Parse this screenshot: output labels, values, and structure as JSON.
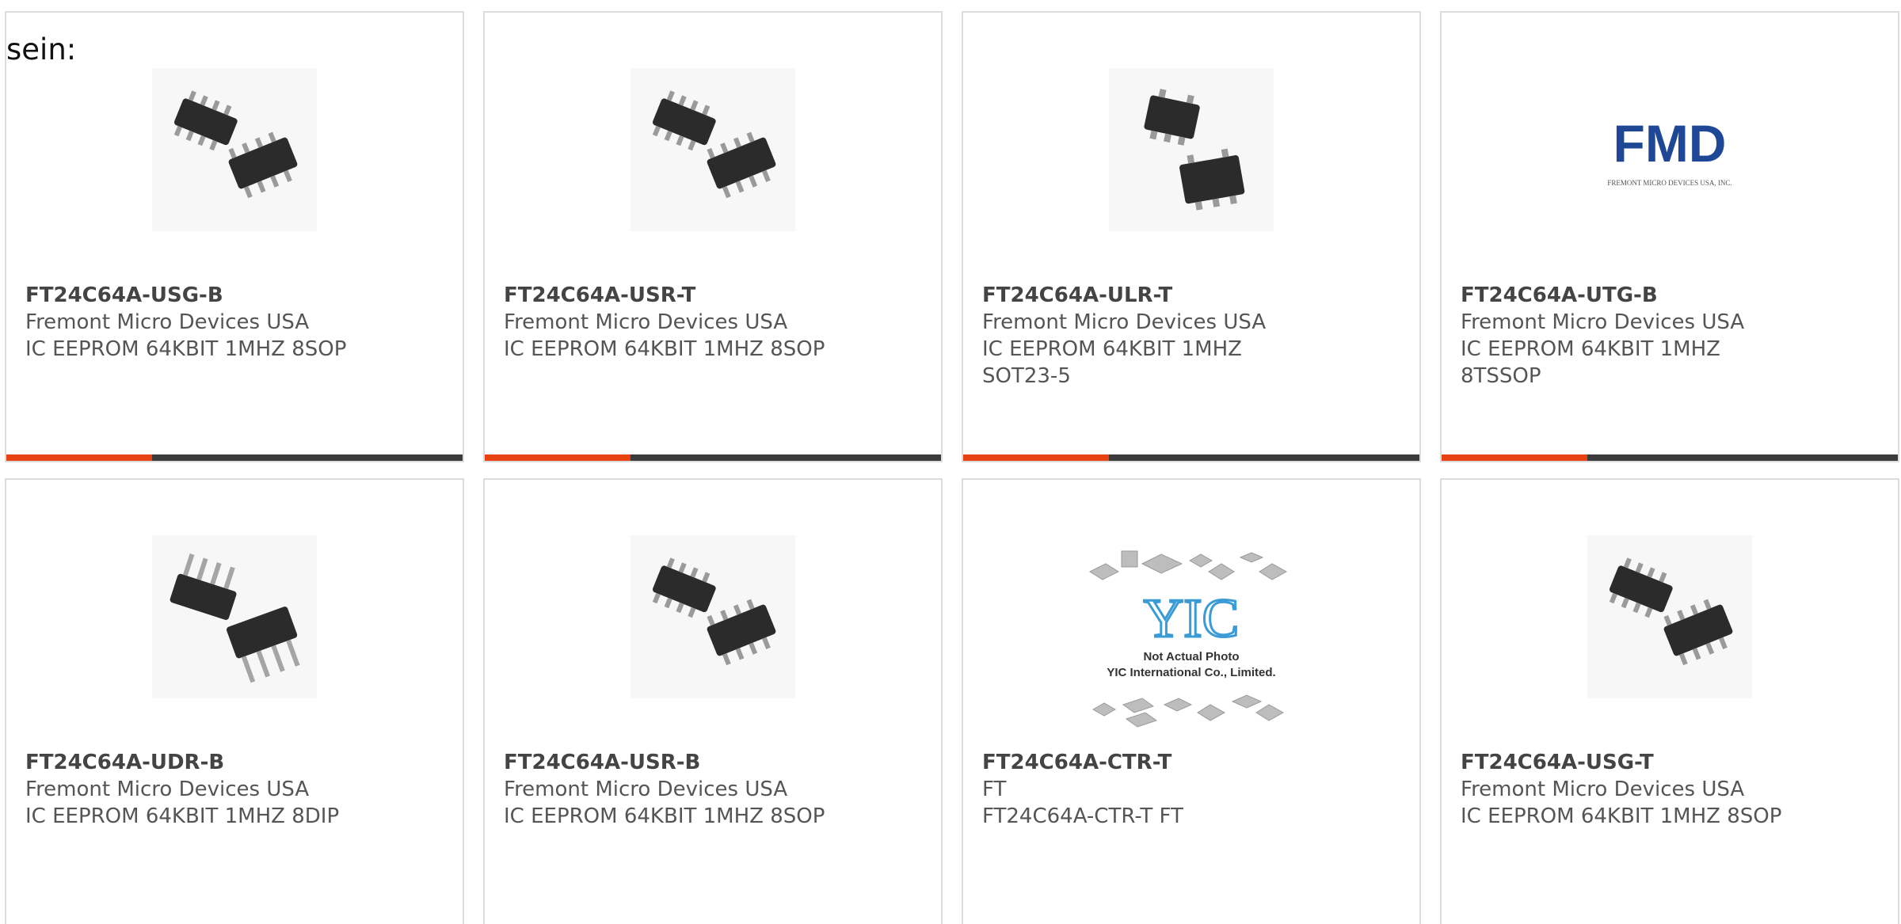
{
  "intro_text": "sein:",
  "colors": {
    "accent": "#e84113",
    "bar": "#3b3b3b",
    "border": "#dcdcdc",
    "text": "#555555",
    "fmd_logo": "#1e4896",
    "yic_logo": "#3a9bd5"
  },
  "products": [
    {
      "part_number": "FT24C64A-USG-B",
      "manufacturer": "Fremont Micro Devices USA",
      "description": "IC EEPROM 64KBIT 1MHZ 8SOP",
      "image_icon": "sop8-chip-icon",
      "progress": 0.32
    },
    {
      "part_number": "FT24C64A-USR-T",
      "manufacturer": "Fremont Micro Devices USA",
      "description": "IC EEPROM 64KBIT 1MHZ 8SOP",
      "image_icon": "sop8-chip-icon",
      "progress": 0.32
    },
    {
      "part_number": "FT24C64A-ULR-T",
      "manufacturer": "Fremont Micro Devices USA",
      "description": "IC EEPROM 64KBIT 1MHZ SOT23-5",
      "image_icon": "sot23-chip-icon",
      "progress": 0.32
    },
    {
      "part_number": "FT24C64A-UTG-B",
      "manufacturer": "Fremont Micro Devices USA",
      "description": "IC EEPROM 64KBIT 1MHZ 8TSSOP",
      "image_icon": "fmd-logo",
      "logo_text": "FMD",
      "logo_subtext": "FREMONT MICRO DEVICES USA, INC.",
      "progress": 0.32
    },
    {
      "part_number": "FT24C64A-UDR-B",
      "manufacturer": "Fremont Micro Devices USA",
      "description": "IC EEPROM 64KBIT 1MHZ 8DIP",
      "image_icon": "dip8-chip-icon"
    },
    {
      "part_number": "FT24C64A-USR-B",
      "manufacturer": "Fremont Micro Devices USA",
      "description": "IC EEPROM 64KBIT 1MHZ 8SOP",
      "image_icon": "sop8-chip-icon"
    },
    {
      "part_number": "FT24C64A-CTR-T",
      "manufacturer": "FT",
      "description": "FT24C64A-CTR-T FT",
      "image_icon": "yic-placeholder-logo",
      "logo_text": "YIC",
      "logo_note1": "Not Actual Photo",
      "logo_note2": "YIC International Co., Limited."
    },
    {
      "part_number": "FT24C64A-USG-T",
      "manufacturer": "Fremont Micro Devices USA",
      "description": "IC EEPROM 64KBIT 1MHZ 8SOP",
      "image_icon": "sop8-chip-icon"
    }
  ]
}
